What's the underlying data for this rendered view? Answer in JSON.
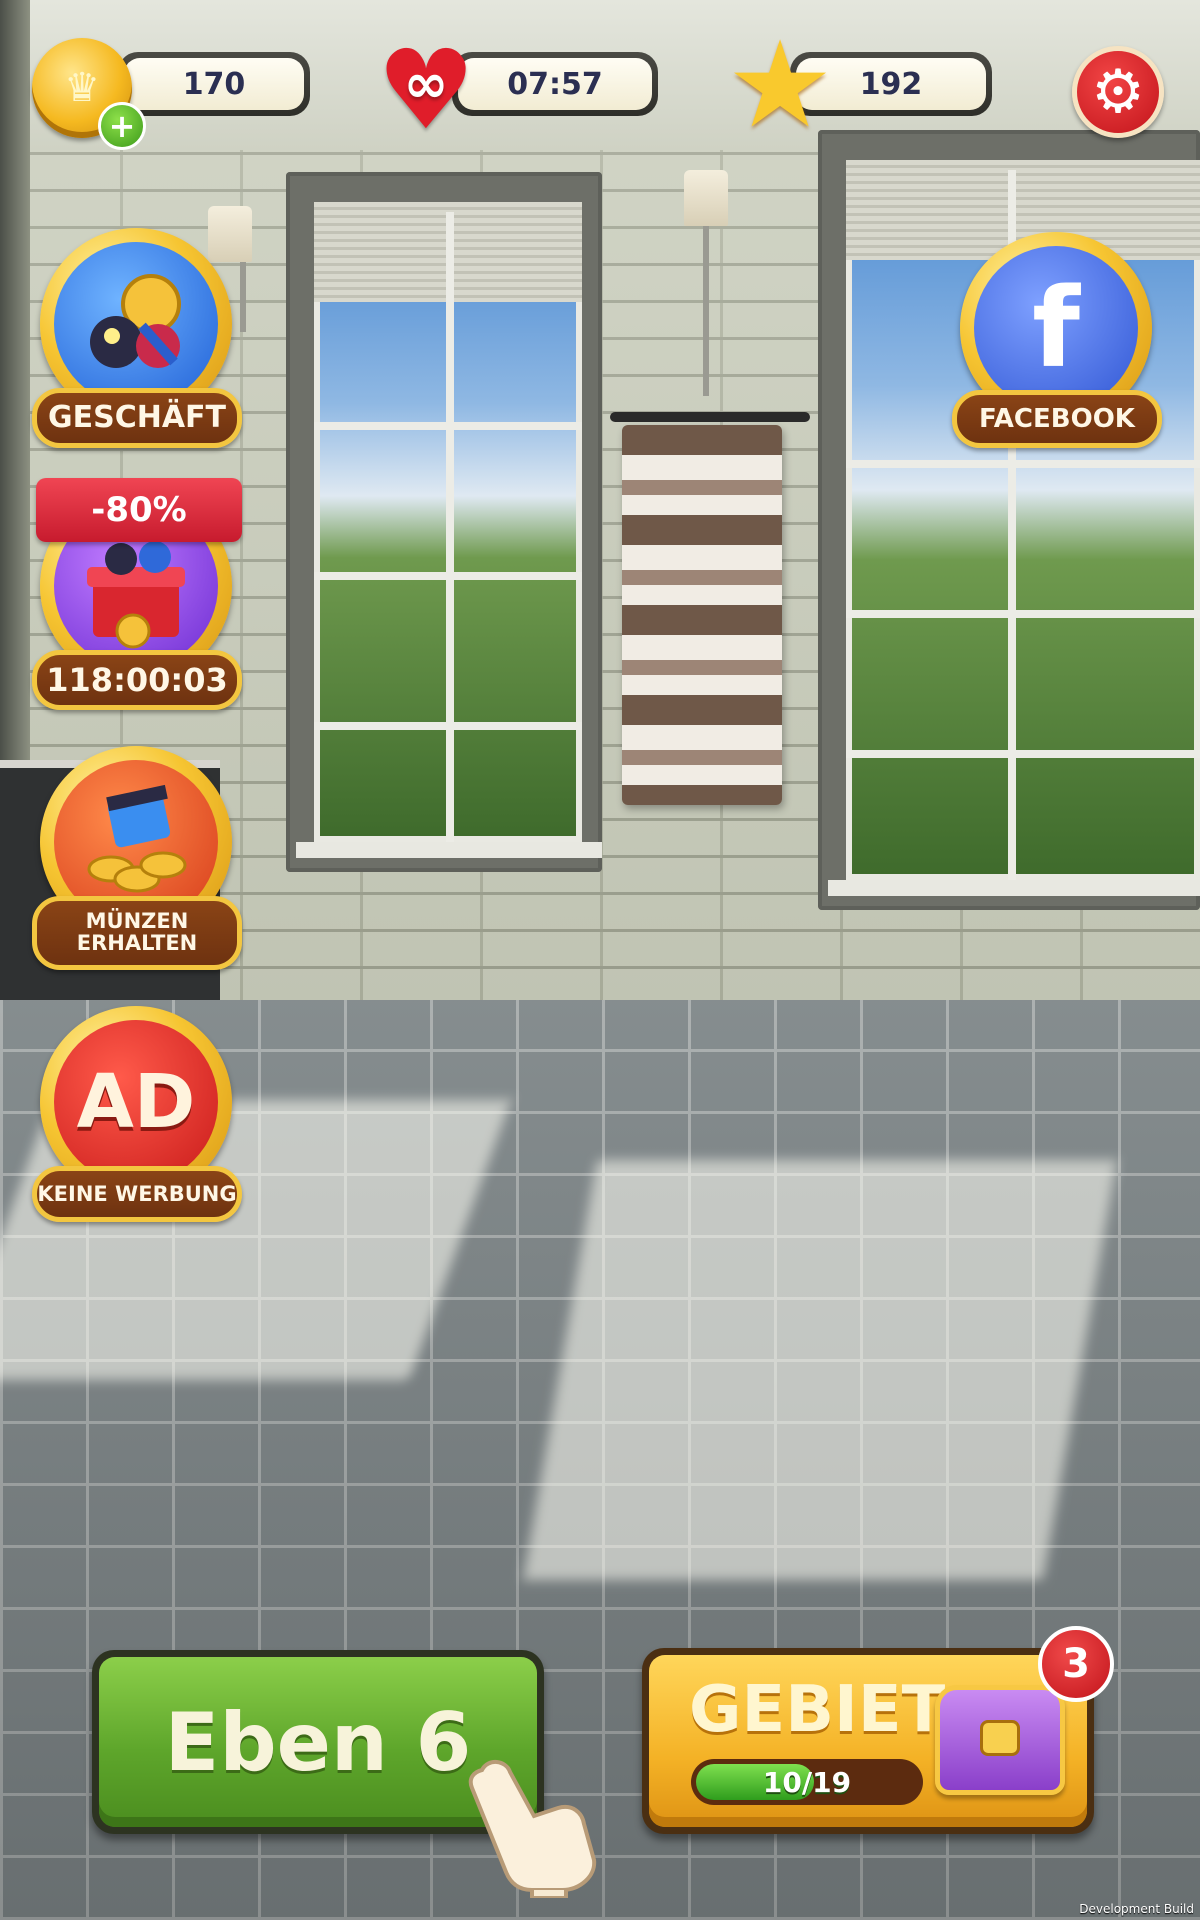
{
  "hud": {
    "coins": {
      "value": "170",
      "icon": "crown-coin-icon",
      "add_icon": "plus-icon"
    },
    "lives": {
      "value": "07:57",
      "icon": "heart-infinity-icon",
      "infinity_glyph": "∞"
    },
    "stars": {
      "value": "192",
      "icon": "star-icon"
    },
    "settings": {
      "icon": "gear-icon"
    }
  },
  "side_buttons": [
    {
      "key": "shop",
      "label": "GESCHÄFT",
      "icon": "shop-boosters-icon"
    },
    {
      "key": "offer",
      "label": "118:00:03",
      "discount": "-80%",
      "icon": "gift-box-icon"
    },
    {
      "key": "coins",
      "label_line1": "MÜNZEN",
      "label_line2": "ERHALTEN",
      "icon": "video-coins-icon"
    },
    {
      "key": "noads",
      "label": "KEINE WERBUNG",
      "icon_text": "AD"
    }
  ],
  "facebook": {
    "label": "FACEBOOK",
    "icon_text": "f"
  },
  "level_button": {
    "label": "Eben 6"
  },
  "area_button": {
    "title": "GEBIET",
    "progress_text": "10/19",
    "progress_fraction": 0.526,
    "badge": "3",
    "icon": "treasure-chest-icon"
  },
  "footer": {
    "dev_build": "Development Build"
  },
  "colors": {
    "level_green": "#5ea62b",
    "area_gold": "#f4b226",
    "badge_red": "#e01d2a"
  }
}
